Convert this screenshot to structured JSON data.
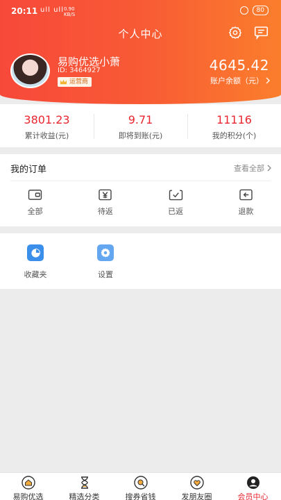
{
  "status": {
    "time": "20:11",
    "network": "ull ull",
    "speed_value": "0.90",
    "speed_unit": "KB/S",
    "battery": "80"
  },
  "header": {
    "title": "个人中心"
  },
  "user": {
    "name": "易购优选小萧",
    "id": "ID: 3464927",
    "role": "运营商"
  },
  "account": {
    "balance": "4645.42",
    "balance_label": "账户余额（元）"
  },
  "stats": [
    {
      "value": "3801.23",
      "label": "累计收益(元)"
    },
    {
      "value": "9.71",
      "label": "即将到账(元)"
    },
    {
      "value": "11116",
      "label": "我的积分(个)"
    }
  ],
  "orders": {
    "title": "我的订单",
    "view_all": "查看全部",
    "items": [
      {
        "label": "全部",
        "icon": "wallet-icon"
      },
      {
        "label": "待返",
        "icon": "yen-icon"
      },
      {
        "label": "已返",
        "icon": "check-icon"
      },
      {
        "label": "退款",
        "icon": "refund-icon"
      }
    ]
  },
  "tools": [
    {
      "label": "收藏夹",
      "icon": "pie-chart-icon"
    },
    {
      "label": "设置",
      "icon": "gear-icon"
    }
  ],
  "tabbar": [
    {
      "label": "易购优选",
      "icon": "home-icon"
    },
    {
      "label": "精选分类",
      "icon": "hourglass-icon"
    },
    {
      "label": "搜券省钱",
      "icon": "search-icon"
    },
    {
      "label": "发朋友圈",
      "icon": "heart-icon"
    },
    {
      "label": "会员中心",
      "icon": "user-icon",
      "active": true
    }
  ],
  "colors": {
    "accent": "#e9252f",
    "header_start": "#f7493a",
    "header_end": "#fb7e2c",
    "badge_text": "#d56c1d",
    "tool_blue": "#3b8fea"
  }
}
